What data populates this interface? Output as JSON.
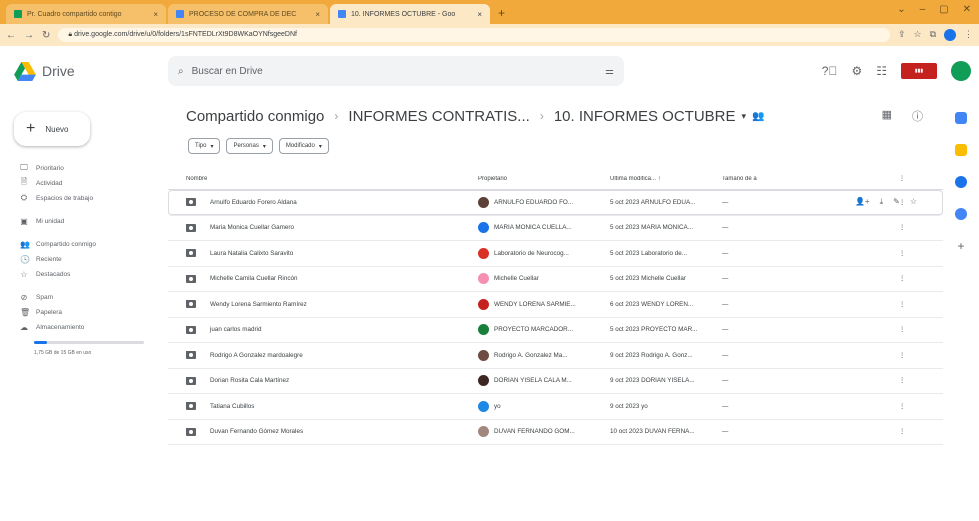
{
  "browser": {
    "tabs": [
      {
        "label": "Pr. Cuadro compartido contigo",
        "active": false
      },
      {
        "label": "PROCESO DE COMPRA DE DEC",
        "active": false
      },
      {
        "label": "10. INFORMES OCTUBRE - Goo",
        "active": true
      }
    ],
    "url": "drive.google.com/drive/u/0/folders/1sFNTEDLrXt9D8WKaOYNfsgeeDNf"
  },
  "app": {
    "name": "Drive"
  },
  "search": {
    "placeholder": "Buscar en Drive"
  },
  "sidebar": {
    "new_label": "Nuevo",
    "items": [
      {
        "icon": "🖵",
        "label": "Prioritario"
      },
      {
        "icon": "🗎",
        "label": "Actividad"
      },
      {
        "icon": "⛭",
        "label": "Espacios de trabajo"
      },
      {
        "icon": "▣",
        "label": "Mi unidad"
      },
      {
        "icon": "👥",
        "label": "Compartido conmigo"
      },
      {
        "icon": "🕓",
        "label": "Reciente"
      },
      {
        "icon": "☆",
        "label": "Destacados"
      },
      {
        "icon": "⊘",
        "label": "Spam"
      },
      {
        "icon": "🗑",
        "label": "Papelera"
      },
      {
        "icon": "☁",
        "label": "Almacenamiento"
      }
    ],
    "storage_text": "1,75 GB de 15 GB en uso",
    "storage_fraction": 0.12
  },
  "breadcrumb": {
    "root": "Compartido conmigo",
    "mid": "INFORMES CONTRATIS...",
    "current": "10. INFORMES OCTUBRE"
  },
  "filters": [
    "Tipo",
    "Personas",
    "Modificado"
  ],
  "table": {
    "headers": {
      "name": "Nombre",
      "owner": "Propietario",
      "modified": "Última modifica...",
      "size": "Tamaño de a"
    },
    "rows": [
      {
        "name": "Arnulfo Eduardo Forero Aldana",
        "owner": "ARNULFO EDUARDO FO...",
        "modified": "5 oct 2023 ARNULFO EDUA...",
        "size": "—",
        "color": "#5d4037"
      },
      {
        "name": "Maria Monica Cuellar Gamero",
        "owner": "MARIA MONICA CUELLA...",
        "modified": "5 oct 2023 MARIA MONICA...",
        "size": "—",
        "color": "#1a73e8"
      },
      {
        "name": "Laura Natalia Calixto Saravito",
        "owner": "Laboratorio de Neurocog...",
        "modified": "5 oct 2023 Laboratorio de...",
        "size": "—",
        "color": "#d93025"
      },
      {
        "name": "Michelle Camila Cuellar Rincón",
        "owner": "Michelle Cuellar",
        "modified": "5 oct 2023 Michelle Cuellar",
        "size": "—",
        "color": "#f48fb1"
      },
      {
        "name": "Wendy Lorena Sarmiento Ramírez",
        "owner": "WENDY LORENA SARMIE...",
        "modified": "6 oct 2023 WENDY LOREN...",
        "size": "—",
        "color": "#c5221f"
      },
      {
        "name": "juan carlos madrid",
        "owner": "PROYECTO MARCADOR...",
        "modified": "5 oct 2023 PROYECTO MAR...",
        "size": "—",
        "color": "#188038"
      },
      {
        "name": "Rodrigo A Gonzalez mardoalegre",
        "owner": "Rodrigo A. Gonzalez Ma...",
        "modified": "9 oct 2023 Rodrigo A. Gonz...",
        "size": "—",
        "color": "#6d4c41"
      },
      {
        "name": "Dorian Rosita Cala Martínez",
        "owner": "DORIAN YISELA CALA M...",
        "modified": "9 oct 2023 DORIAN YISELA...",
        "size": "—",
        "color": "#3e2723"
      },
      {
        "name": "Tatiana Cubillos",
        "owner": "yo",
        "modified": "9 oct 2023 yo",
        "size": "—",
        "color": "#1e88e5"
      },
      {
        "name": "Duvan Fernando Gómez Morales",
        "owner": "DUVAN FERNANDO GOM...",
        "modified": "10 oct 2023 DUVAN FERNA...",
        "size": "—",
        "color": "#a1887f"
      }
    ]
  }
}
